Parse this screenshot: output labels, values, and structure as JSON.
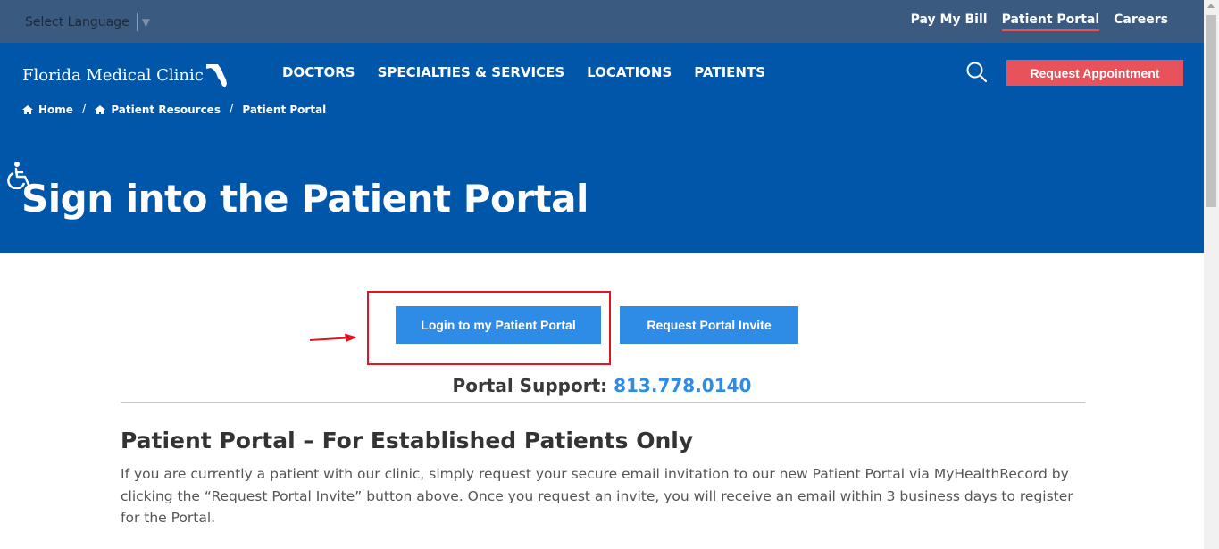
{
  "utility_bar": {
    "language_select": {
      "label": "Select Language",
      "caret": "▼"
    },
    "links": [
      {
        "label": "Pay My Bill",
        "active": false
      },
      {
        "label": "Patient Portal",
        "active": true
      },
      {
        "label": "Careers",
        "active": false
      }
    ]
  },
  "header": {
    "logo_text": "Florida Medical Clinic",
    "nav": [
      "DOCTORS",
      "SPECIALTIES & SERVICES",
      "LOCATIONS",
      "PATIENTS"
    ],
    "search_icon": "search-icon",
    "request_appointment": "Request Appointment"
  },
  "breadcrumb": {
    "items": [
      "Home",
      "Patient Resources",
      "Patient Portal"
    ],
    "separator": "/"
  },
  "accessibility_icon": "wheelchair-icon",
  "page_title": "Sign into the Patient Portal",
  "actions": {
    "login_button": "Login to my Patient Portal",
    "invite_button": "Request Portal Invite"
  },
  "support": {
    "label": "Portal Support:",
    "phone": "813.778.0140"
  },
  "section": {
    "title": "Patient Portal – For Established Patients Only",
    "body": "If you are currently a patient with our clinic, simply request your secure email invitation to our new Patient Portal via MyHealthRecord by clicking the “Request Portal Invite” button above. Once you request an invite, you will receive an email within 3 business days to register for the Portal."
  },
  "colors": {
    "utility_bar": "#3a5a80",
    "hero": "#0056a8",
    "accent_red": "#e8525b",
    "button_blue": "#2e8be6",
    "annotation_red": "#e0161f"
  }
}
